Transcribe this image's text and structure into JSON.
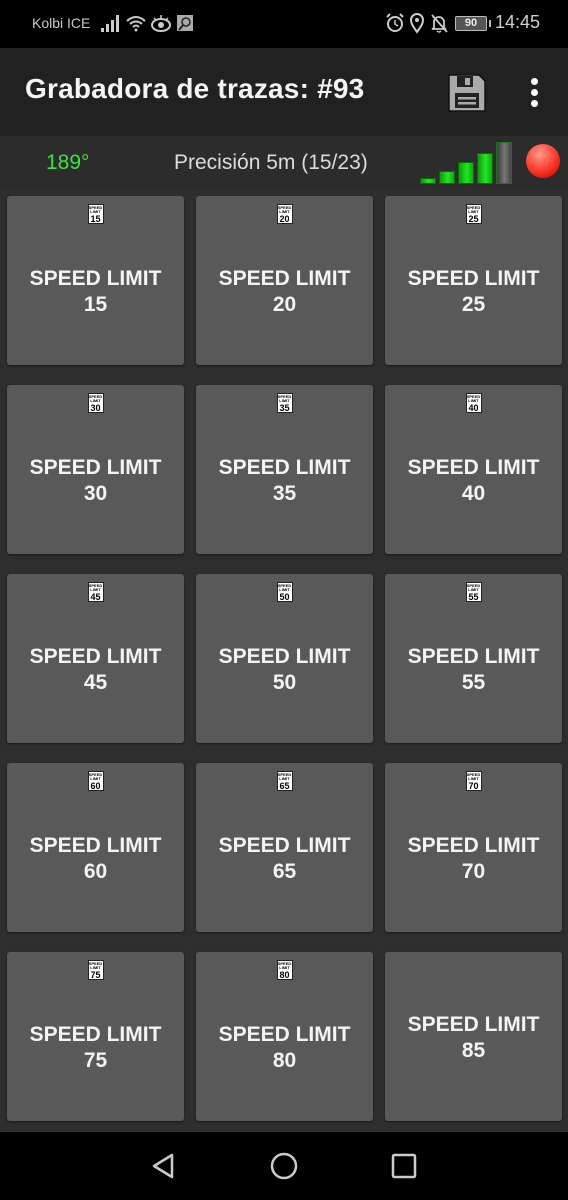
{
  "status_bar": {
    "carrier": "Kolbi ICE",
    "left_icons": [
      "cell-signal-icon",
      "wifi-icon",
      "eye-comfort-icon",
      "screenshot-icon"
    ],
    "right_icons": [
      "alarm-icon",
      "location-icon",
      "notifications-off-icon"
    ],
    "battery": "90",
    "time": "14:45"
  },
  "app_bar": {
    "title": "Grabadora de trazas: #93",
    "actions": [
      "save-icon",
      "more-vert-icon"
    ]
  },
  "gps": {
    "heading": "189°",
    "precision": "Precisión 5m (15/23)",
    "signal_bars_filled": 4,
    "signal_bars_total": 5,
    "recording_indicator": "red-dot",
    "colors": {
      "heading": "#3ee23e",
      "signal": "#22e622",
      "record": "#e81a0a"
    }
  },
  "tiles": [
    {
      "line1": "SPEED LIMIT",
      "line2": "15",
      "icon_num": "15",
      "icon_text": "SPEED LIMIT"
    },
    {
      "line1": "SPEED LIMIT",
      "line2": "20",
      "icon_num": "20",
      "icon_text": "SPEED LIMIT"
    },
    {
      "line1": "SPEED LIMIT",
      "line2": "25",
      "icon_num": "25",
      "icon_text": "SPEED LIMIT"
    },
    {
      "line1": "SPEED LIMIT",
      "line2": "30",
      "icon_num": "30",
      "icon_text": "SPEED LIMIT"
    },
    {
      "line1": "SPEED LIMIT",
      "line2": "35",
      "icon_num": "35",
      "icon_text": "SPEED LIMIT"
    },
    {
      "line1": "SPEED LIMIT",
      "line2": "40",
      "icon_num": "40",
      "icon_text": "SPEED LIMIT"
    },
    {
      "line1": "SPEED LIMIT",
      "line2": "45",
      "icon_num": "45",
      "icon_text": "SPEED LIMIT"
    },
    {
      "line1": "SPEED LIMIT",
      "line2": "50",
      "icon_num": "50",
      "icon_text": "SPEED LIMIT"
    },
    {
      "line1": "SPEED LIMIT",
      "line2": "55",
      "icon_num": "55",
      "icon_text": "SPEED LIMIT"
    },
    {
      "line1": "SPEED LIMIT",
      "line2": "60",
      "icon_num": "60",
      "icon_text": "SPEED LIMIT"
    },
    {
      "line1": "SPEED LIMIT",
      "line2": "65",
      "icon_num": "65",
      "icon_text": "SPEED LIMIT"
    },
    {
      "line1": "SPEED LIMIT",
      "line2": "70",
      "icon_num": "70",
      "icon_text": "SPEED LIMIT"
    },
    {
      "line1": "SPEED LIMIT",
      "line2": "75",
      "icon_num": "75",
      "icon_text": "SPEED LIMIT"
    },
    {
      "line1": "SPEED LIMIT",
      "line2": "80",
      "icon_num": "80",
      "icon_text": "SPEED LIMIT"
    },
    {
      "line1": "SPEED LIMIT",
      "line2": "85",
      "icon_num": null,
      "icon_text": null
    }
  ],
  "nav_bar": {
    "buttons": [
      "back-icon",
      "home-icon",
      "recents-icon"
    ]
  }
}
